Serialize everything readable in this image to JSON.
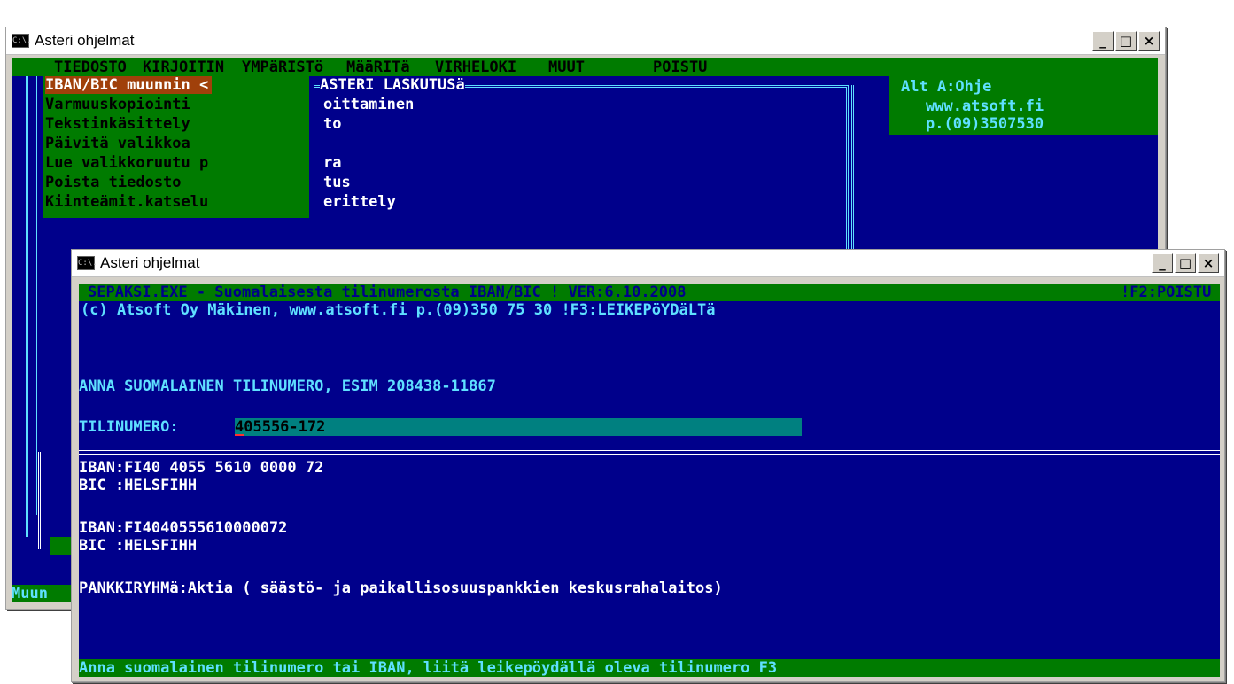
{
  "back": {
    "title": "Asteri ohjelmat",
    "menu": [
      "TIEDOSTO",
      "KIRJOITIN",
      "YMPäRISTö",
      "MääRITä",
      "VIRHELOKI",
      "MUUT",
      "POISTU"
    ],
    "items": [
      "IBAN/BIC muunnin <",
      "Varmuuskopiointi",
      "Tekstinkäsittely",
      "Päivitä valikkoa",
      "Lue valikkoruutu p",
      "Poista tiedosto",
      "Kiinteämit.katselu"
    ],
    "sub_title": "ASTERI LASKUTUSä",
    "sub_items": [
      "oittaminen",
      "to",
      "",
      "ra",
      "tus",
      "erittely"
    ],
    "info": [
      "Alt A:Ohje",
      "www.atsoft.fi",
      "p.(09)3507530"
    ],
    "status": "Muun"
  },
  "front": {
    "title": "Asteri ohjelmat",
    "header1": "SEPAKSI.EXE - Suomalaisesta tilinumerosta IBAN/BIC ! VER:6.10.2008",
    "f2": "!F2:POISTU",
    "header2": "(c) Atsoft Oy Mäkinen, www.atsoft.fi p.(09)350 75 30 !F3:LEIKEPöYDäLTä",
    "prompt": "ANNA SUOMALAINEN TILINUMERO, ESIM 208438-11867",
    "field_label": "TILINUMERO:",
    "field_value": "405556-172",
    "iban1": "IBAN:FI40 4055 5610 0000 72",
    "bic1": "BIC :HELSFIHH",
    "iban2": "IBAN:FI4040555610000072",
    "bic2": "BIC :HELSFIHH",
    "bank": "PANKKIRYHMä:Aktia ( säästö- ja paikallisosuuspankkien keskusrahalaitos)",
    "status": "Anna suomalainen tilinumero tai IBAN, liitä leikepöydällä oleva tilinumero F3"
  },
  "controls": {
    "min": "_",
    "max": "□",
    "close": "×"
  },
  "icon_label": "C:\\."
}
